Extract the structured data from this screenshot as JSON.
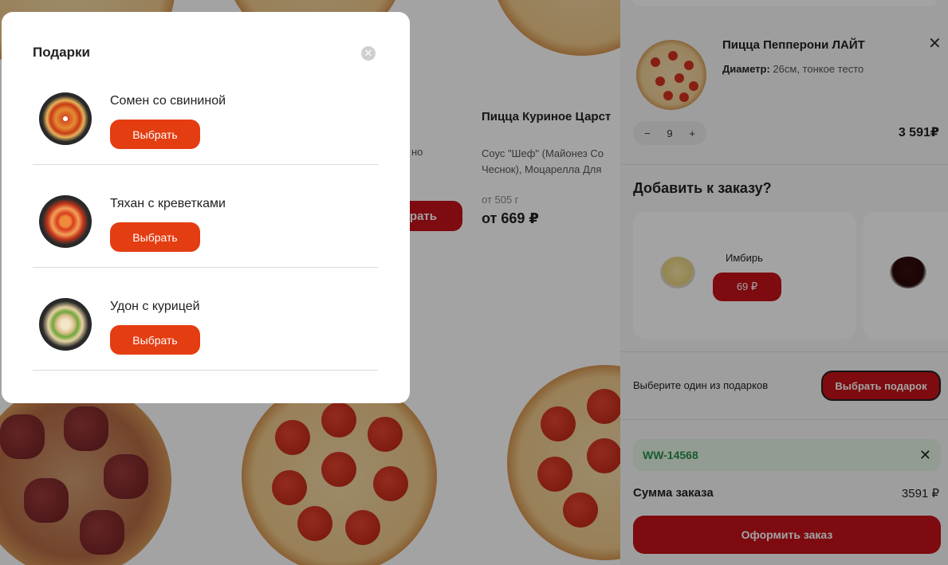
{
  "catalog": {
    "product_title": "Пицца Куриное Царст",
    "product_desc": "Соус \"Шеф\" (Майонез Со Чеснок), Моцарелла Для",
    "product_weight": "от 505 г",
    "product_price": "от 669 ₽",
    "partial_desc": "но",
    "partial_btn": "рать"
  },
  "cart": {
    "item": {
      "title": "Пицца Пепперони ЛАЙТ",
      "option_label": "Диаметр:",
      "option_value": "26см, тонкое тесто",
      "qty": "9",
      "minus": "−",
      "plus": "+",
      "price": "3 591₽",
      "remove": "✕"
    },
    "addons_title": "Добавить к заказу?",
    "addons": [
      {
        "name": "Имбирь",
        "price": "69 ₽"
      }
    ],
    "gift_label": "Выберите один из подарков",
    "gift_button": "Выбрать подарок",
    "promo_code": "WW-14568",
    "promo_remove": "✕",
    "sum_label": "Сумма заказа",
    "sum_value": "3591 ₽",
    "checkout": "Оформить заказ"
  },
  "modal": {
    "title": "Подарки",
    "close": "✕",
    "gifts": [
      {
        "name": "Сомен со свининой",
        "button": "Выбрать"
      },
      {
        "name": "Тяхан с креветками",
        "button": "Выбрать"
      },
      {
        "name": "Удон с курицей",
        "button": "Выбрать"
      }
    ]
  },
  "colors": {
    "brand_red": "#c4121a",
    "gift_orange": "#e43d12",
    "promo_green": "#2a8f47"
  }
}
